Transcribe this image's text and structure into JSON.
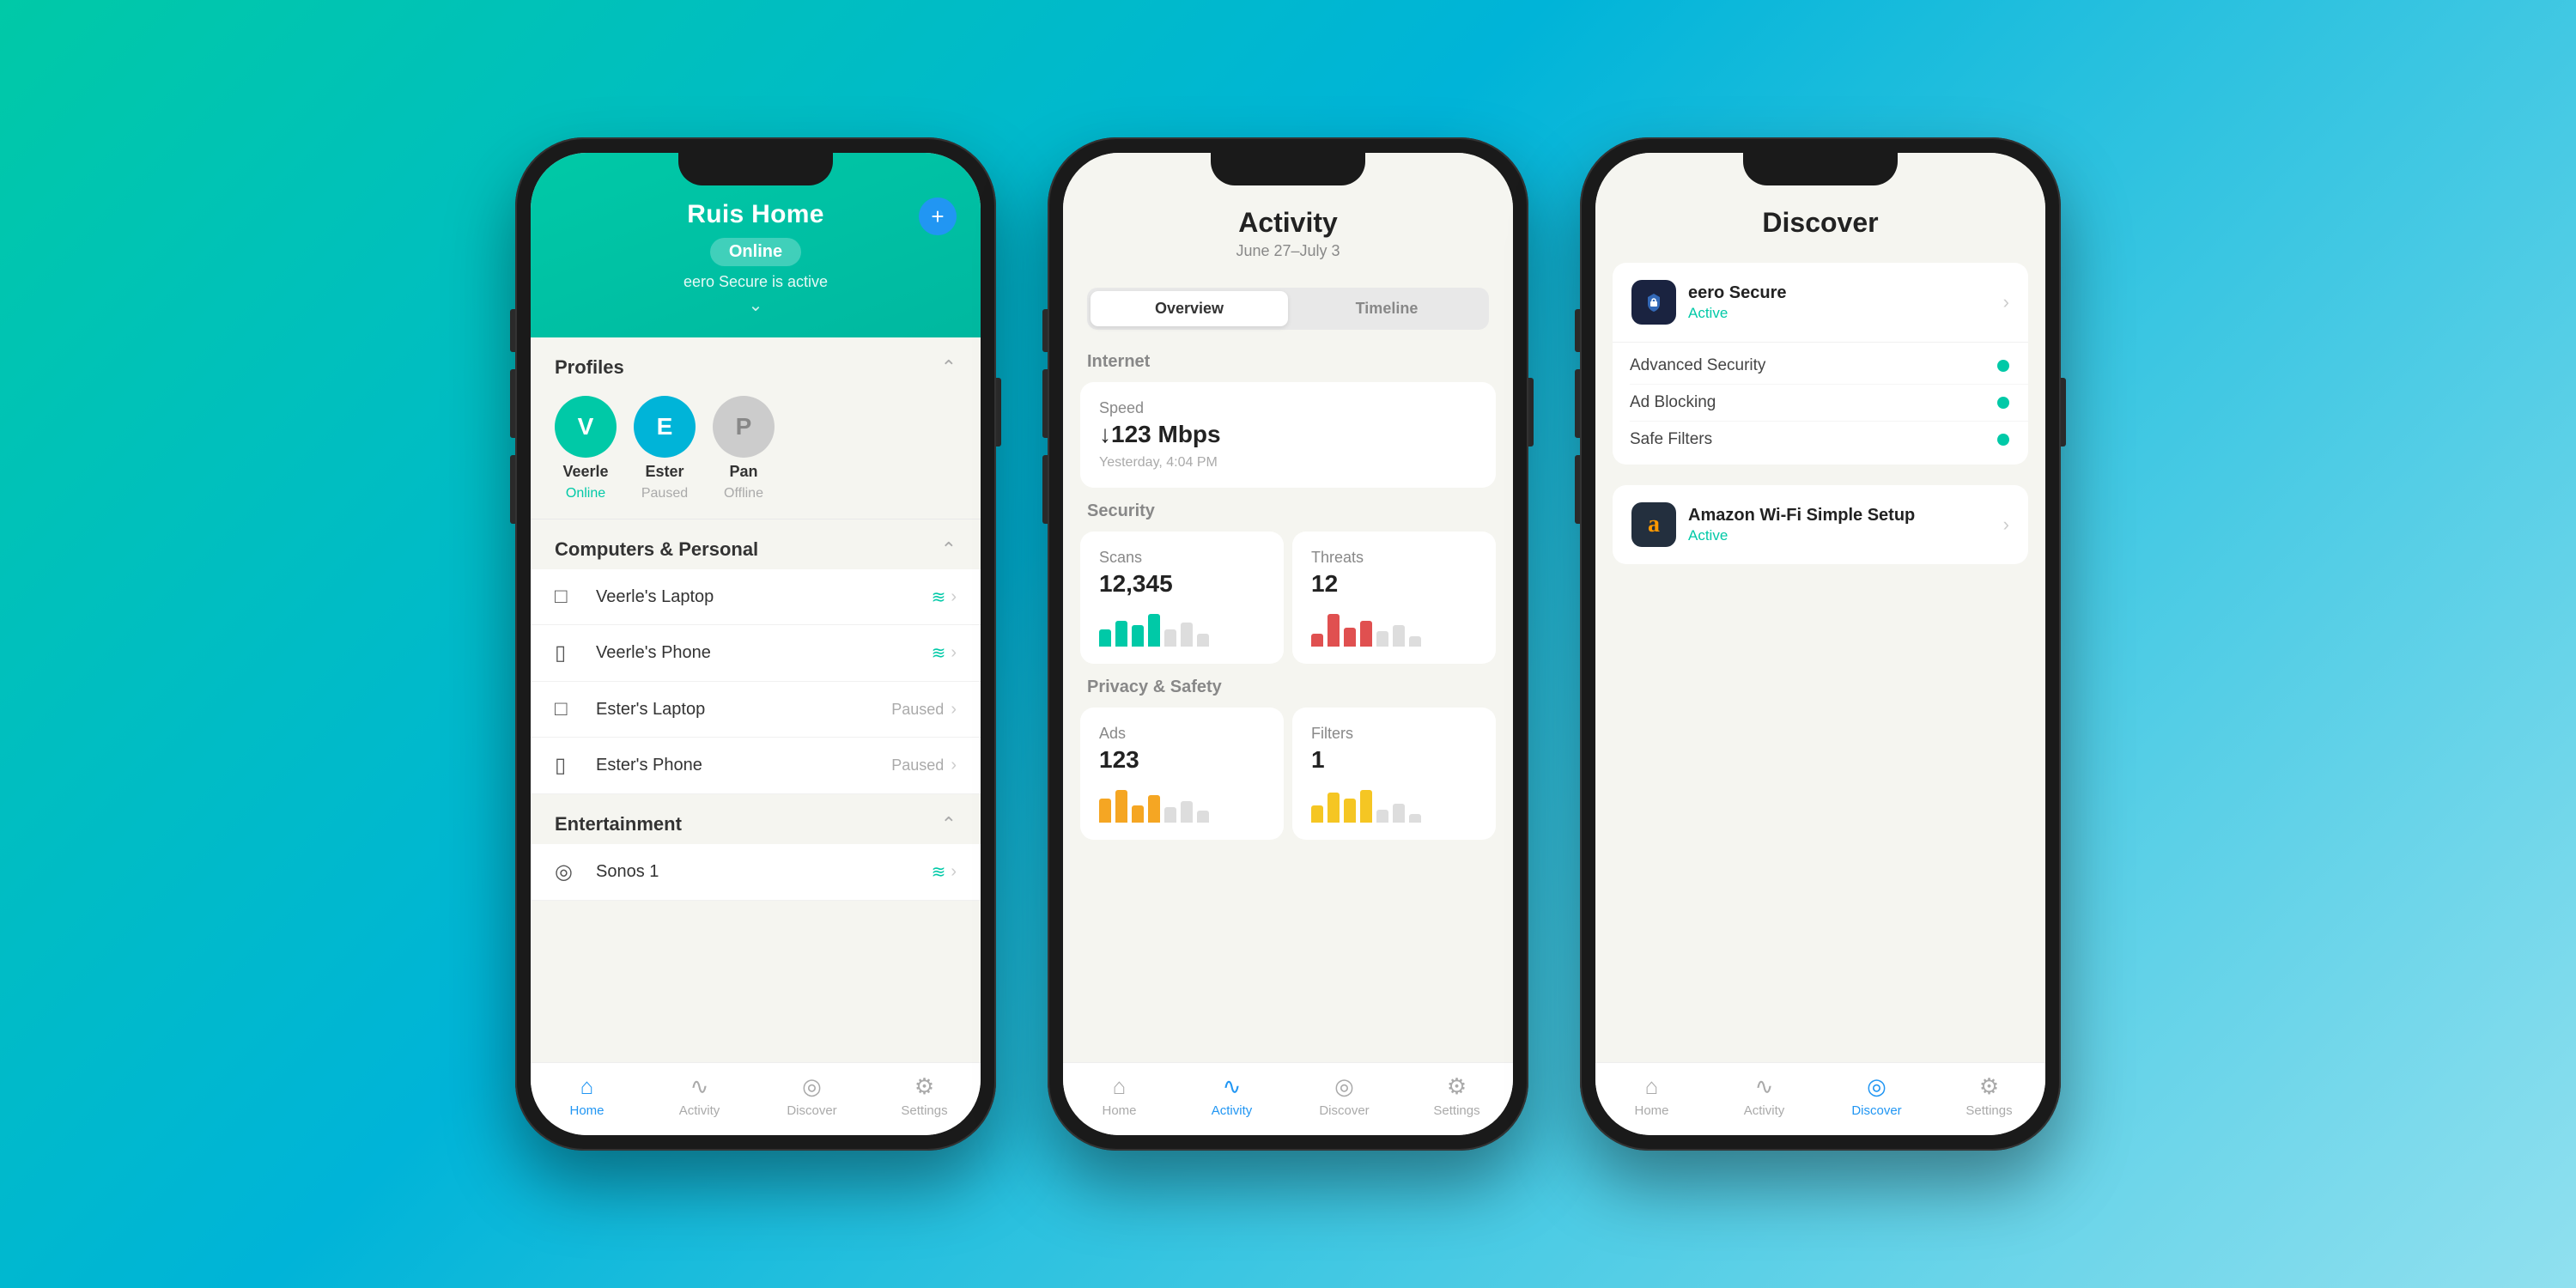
{
  "background": {
    "gradient_start": "#00c9a7",
    "gradient_end": "#90e0ef"
  },
  "phone1": {
    "title": "Ruis Home",
    "status": "Online",
    "subtitle": "eero Secure is active",
    "plus_label": "+",
    "profiles_label": "Profiles",
    "profiles": [
      {
        "initial": "V",
        "name": "Veerle",
        "status": "Online",
        "color": "green"
      },
      {
        "initial": "E",
        "name": "Ester",
        "status": "Paused",
        "color": "teal"
      },
      {
        "initial": "P",
        "name": "Pan",
        "status": "Offline",
        "color": "gray"
      }
    ],
    "computers_section": "Computers & Personal",
    "devices": [
      {
        "icon": "💻",
        "name": "Veerle's Laptop",
        "status": "wifi",
        "type": "laptop"
      },
      {
        "icon": "📱",
        "name": "Veerle's Phone",
        "status": "wifi",
        "type": "phone"
      },
      {
        "icon": "💻",
        "name": "Ester's Laptop",
        "status": "Paused",
        "type": "laptop"
      },
      {
        "icon": "📱",
        "name": "Ester's Phone",
        "status": "Paused",
        "type": "phone"
      }
    ],
    "entertainment_label": "Entertainment",
    "entertainment_devices": [
      {
        "icon": "🔊",
        "name": "Sonos 1",
        "status": "wifi"
      }
    ],
    "nav": {
      "home": "Home",
      "activity": "Activity",
      "discover": "Discover",
      "settings": "Settings"
    }
  },
  "phone2": {
    "title": "Activity",
    "date_range": "June 27–July 3",
    "tab_overview": "Overview",
    "tab_timeline": "Timeline",
    "internet_label": "Internet",
    "speed_label": "Speed",
    "speed_value": "↓123 Mbps",
    "speed_time": "Yesterday, 4:04 PM",
    "security_label": "Security",
    "scans_label": "Scans",
    "scans_value": "12,345",
    "threats_label": "Threats",
    "threats_value": "12",
    "privacy_label": "Privacy & Safety",
    "ads_label": "Ads",
    "ads_value": "123",
    "filters_label": "Filters",
    "filters_value": "1",
    "nav": {
      "home": "Home",
      "activity": "Activity",
      "discover": "Discover",
      "settings": "Settings"
    }
  },
  "phone3": {
    "title": "Discover",
    "eero_secure_name": "eero Secure",
    "eero_secure_status": "Active",
    "eero_secure_icon": "🔒",
    "features": [
      {
        "label": "Advanced Security",
        "dot_color": "#00c9a7"
      },
      {
        "label": "Ad Blocking",
        "dot_color": "#00c9a7"
      },
      {
        "label": "Safe Filters",
        "dot_color": "#00c9a7"
      }
    ],
    "amazon_name": "Amazon Wi-Fi Simple Setup",
    "amazon_status": "Active",
    "amazon_icon": "a",
    "nav": {
      "home": "Home",
      "activity": "Activity",
      "discover": "Discover",
      "settings": "Settings"
    }
  }
}
